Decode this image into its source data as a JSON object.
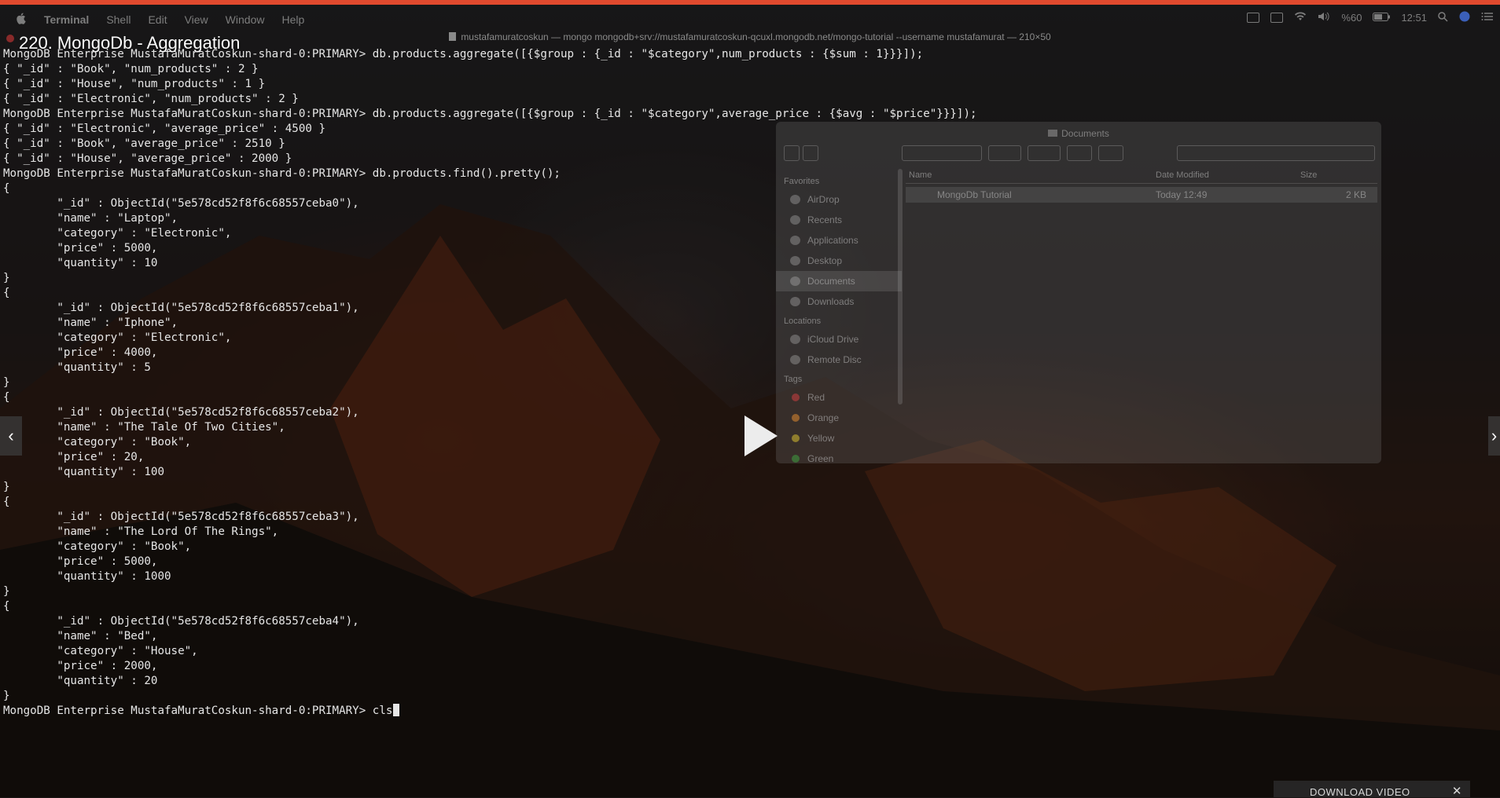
{
  "menubar": {
    "app": "Terminal",
    "items": [
      "Shell",
      "Edit",
      "View",
      "Window",
      "Help"
    ],
    "battery": "%60",
    "clock": "12:51"
  },
  "terminal_title": "mustafamuratcoskun — mongo mongodb+srv://mustafamuratcoskun-qcuxl.mongodb.net/mongo-tutorial --username mustafamurat — 210×50",
  "video_title": "220. MongoDb - Aggregation",
  "terminal_lines": [
    "MongoDB Enterprise MustafaMuratCoskun-shard-0:PRIMARY> db.products.aggregate([{$group : {_id : \"$category\",num_products : {$sum : 1}}}]);",
    "{ \"_id\" : \"Book\", \"num_products\" : 2 }",
    "{ \"_id\" : \"House\", \"num_products\" : 1 }",
    "{ \"_id\" : \"Electronic\", \"num_products\" : 2 }",
    "MongoDB Enterprise MustafaMuratCoskun-shard-0:PRIMARY> db.products.aggregate([{$group : {_id : \"$category\",average_price : {$avg : \"$price\"}}}]);",
    "{ \"_id\" : \"Electronic\", \"average_price\" : 4500 }",
    "{ \"_id\" : \"Book\", \"average_price\" : 2510 }",
    "{ \"_id\" : \"House\", \"average_price\" : 2000 }",
    "MongoDB Enterprise MustafaMuratCoskun-shard-0:PRIMARY> db.products.find().pretty();",
    "{",
    "        \"_id\" : ObjectId(\"5e578cd52f8f6c68557ceba0\"),",
    "        \"name\" : \"Laptop\",",
    "        \"category\" : \"Electronic\",",
    "        \"price\" : 5000,",
    "        \"quantity\" : 10",
    "}",
    "{",
    "        \"_id\" : ObjectId(\"5e578cd52f8f6c68557ceba1\"),",
    "        \"name\" : \"Iphone\",",
    "        \"category\" : \"Electronic\",",
    "        \"price\" : 4000,",
    "        \"quantity\" : 5",
    "}",
    "{",
    "        \"_id\" : ObjectId(\"5e578cd52f8f6c68557ceba2\"),",
    "        \"name\" : \"The Tale Of Two Cities\",",
    "        \"category\" : \"Book\",",
    "        \"price\" : 20,",
    "        \"quantity\" : 100",
    "}",
    "{",
    "        \"_id\" : ObjectId(\"5e578cd52f8f6c68557ceba3\"),",
    "        \"name\" : \"The Lord Of The Rings\",",
    "        \"category\" : \"Book\",",
    "        \"price\" : 5000,",
    "        \"quantity\" : 1000",
    "}",
    "{",
    "        \"_id\" : ObjectId(\"5e578cd52f8f6c68557ceba4\"),",
    "        \"name\" : \"Bed\",",
    "        \"category\" : \"House\",",
    "        \"price\" : 2000,",
    "        \"quantity\" : 20",
    "}"
  ],
  "prompt_line": {
    "prompt": "MongoDB Enterprise MustafaMuratCoskun-shard-0:PRIMARY> ",
    "input": "cls"
  },
  "finder": {
    "title": "Documents",
    "sidebar_sections": [
      {
        "heading": "Favorites",
        "items": [
          "AirDrop",
          "Recents",
          "Applications",
          "Desktop",
          "Documents",
          "Downloads"
        ]
      },
      {
        "heading": "Locations",
        "items": [
          "iCloud Drive",
          "Remote Disc"
        ]
      }
    ],
    "tags_heading": "Tags",
    "tags": [
      {
        "name": "Red",
        "color": "#d04040"
      },
      {
        "name": "Orange",
        "color": "#e08a30"
      },
      {
        "name": "Yellow",
        "color": "#d8c030"
      },
      {
        "name": "Green",
        "color": "#40a040"
      }
    ],
    "columns": [
      "Name",
      "Date Modified",
      "Size"
    ],
    "row": {
      "name": "MongoDb Tutorial",
      "date": "Today 12:49",
      "size": "2 KB"
    }
  },
  "player": {
    "download_label": "DOWNLOAD VIDEO",
    "close_glyph": "✕",
    "prev_glyph": "‹",
    "next_glyph": "›"
  },
  "colors": {
    "progress": "#e04a2e",
    "terminal_text": "#e6e6e6"
  }
}
